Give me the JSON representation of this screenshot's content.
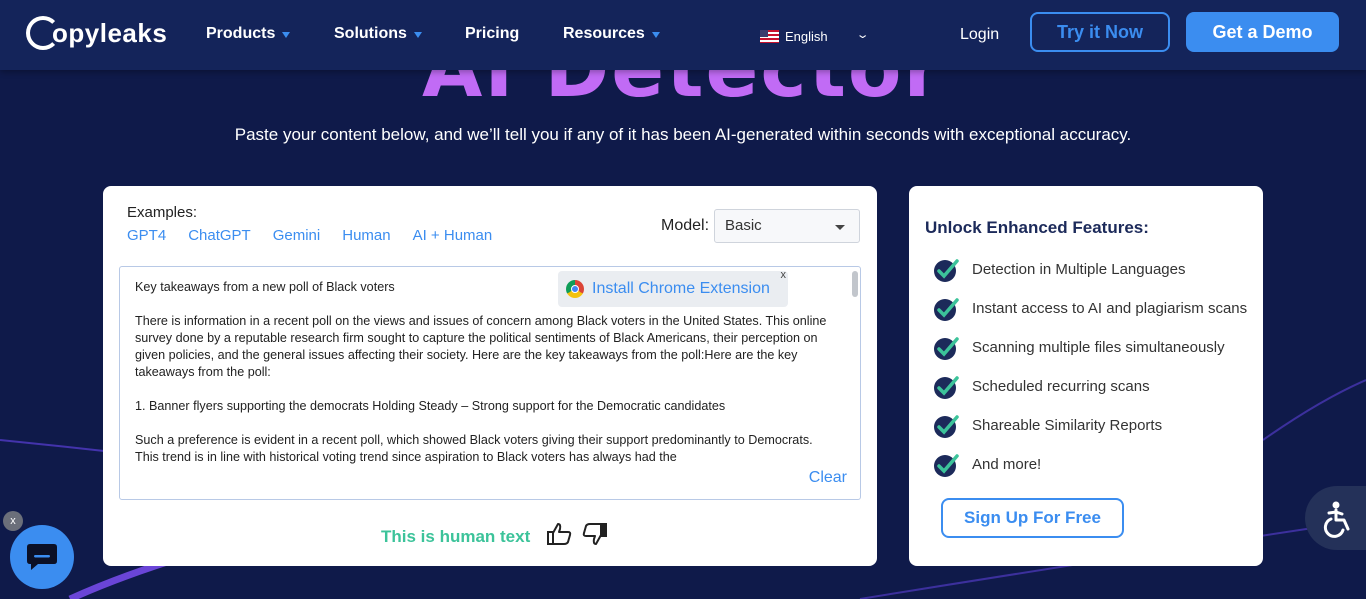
{
  "page": {
    "hero_title": "AI Detector",
    "subtitle": "Paste your content below, and we’ll tell you if any of it has been AI-generated within seconds with exceptional accuracy."
  },
  "nav": {
    "logo_text": "opyleaks",
    "products": "Products",
    "solutions": "Solutions",
    "pricing": "Pricing",
    "resources": "Resources",
    "language": "English",
    "login": "Login",
    "try_now": "Try it Now",
    "get_demo": "Get a Demo"
  },
  "detector": {
    "examples_label": "Examples:",
    "examples": [
      "GPT4",
      "ChatGPT",
      "Gemini",
      "Human",
      "AI + Human"
    ],
    "model_label": "Model:",
    "model_value": "Basic",
    "chrome_extension": "Install Chrome Extension",
    "chrome_close": "x",
    "paragraphs": [
      "Key takeaways from a new poll of Black voters",
      "There is information in a recent poll on the views and issues of concern among Black voters in the United States. This online survey done by a reputable research firm sought to capture the political sentiments of Black Americans, their perception on given policies, and the general issues affecting their society. Here are the key takeaways from the poll:Here are the key takeaways from the poll:",
      "1. Banner flyers supporting the democrats Holding Steady – Strong support for the Democratic candidates",
      "Such a preference is evident in a recent poll, which showed Black voters giving their support predominantly to Democrats. This trend is in line with historical voting trend since aspiration to Black voters has always had the"
    ],
    "clear": "Clear",
    "result": "This is human text"
  },
  "features_panel": {
    "title": "Unlock Enhanced Features:",
    "items": [
      "Detection in Multiple Languages",
      "Instant access to AI and plagiarism scans",
      "Scanning multiple files simultaneously",
      "Scheduled recurring scans",
      "Shareable Similarity Reports",
      "And more!"
    ],
    "signup": "Sign Up For Free"
  },
  "widgets": {
    "chat_close": "x"
  },
  "colors": {
    "background": "#0f1a4a",
    "nav": "#14245a",
    "accent": "#3b8df0",
    "hero": "#c16bf5",
    "result": "#3cc39a",
    "check": "#3cc39a"
  },
  "icons": [
    "chevron-down-icon",
    "flag-us-icon",
    "chrome-icon",
    "thumbs-up-icon",
    "thumbs-down-icon",
    "check-icon",
    "chat-icon",
    "accessibility-icon"
  ]
}
